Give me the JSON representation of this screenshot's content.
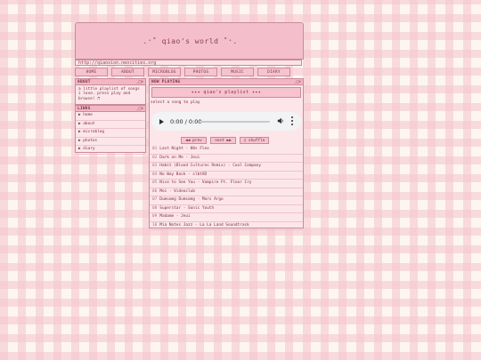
{
  "header": {
    "title": ".⁺˚ qiao's world ˚⁺."
  },
  "urlbar": {
    "url": "http://qiaoxion.neocities.org"
  },
  "nav": {
    "tabs": [
      "HOME",
      "ABOUT",
      "MICROBLOG",
      "PHOTOS",
      "MUSIC",
      "DIARY"
    ]
  },
  "about": {
    "title": "ABOUT",
    "controls": "_□✕",
    "text": "a little playlist of songs i love. press play and browse! ♬"
  },
  "links": {
    "title": "LINKS",
    "controls": "_□✕",
    "items": [
      "▶ home",
      "▶ about",
      "▶ microblog",
      "▶ photos",
      "▶ diary"
    ]
  },
  "now_playing": {
    "title": "NOW PLAYING",
    "controls": "_□✕",
    "banner": "✦✦✦  qiao's playlist  ✦✦✦",
    "hint": "select a song to play",
    "time": "0:00 / 0:00",
    "prev_label": "◀◀ prev",
    "next_label": "next ▶▶",
    "shuffle_label": "♫ shuffle",
    "tracks": [
      {
        "num": "01",
        "title": "Last Night - 88s Flex"
      },
      {
        "num": "02",
        "title": "Dark on Me - Jeui"
      },
      {
        "num": "03",
        "title": "Habit (Blood Cultures Remix) - Cool Company"
      },
      {
        "num": "04",
        "title": "No Way Back - slbtXD"
      },
      {
        "num": "05",
        "title": "Nice to See You - Vampire Ft. Floor Cry"
      },
      {
        "num": "06",
        "title": "Moi - Videoclub"
      },
      {
        "num": "07",
        "title": "Dumsomg Dumsomg - Mars Argo"
      },
      {
        "num": "08",
        "title": "Superstar - Sonic Youth"
      },
      {
        "num": "09",
        "title": "Madame - Jeui"
      },
      {
        "num": "10",
        "title": "Mia Notes Jazz - La La Land Soundtrack"
      }
    ]
  }
}
